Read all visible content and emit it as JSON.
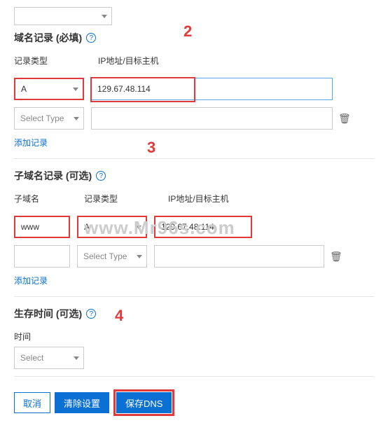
{
  "top_select_placeholder": "",
  "sections": {
    "domain_records": {
      "title": "域名记录 (必填)"
    },
    "subdomain_records": {
      "title": "子域名记录 (可选)"
    },
    "ttl": {
      "title": "生存时间 (可选)"
    }
  },
  "labels": {
    "record_type": "记录类型",
    "ip_target": "IP地址/目标主机",
    "subdomain": "子域名",
    "time": "时间"
  },
  "domain_rows": [
    {
      "type": "A",
      "ip": "129.67.48.114"
    },
    {
      "type": "Select Type",
      "ip": ""
    }
  ],
  "subdomain_rows": [
    {
      "sub": "www",
      "type": "A",
      "ip": "129.67.48.114"
    },
    {
      "sub": "",
      "type": "Select Type",
      "ip": ""
    }
  ],
  "ttl_select": "Select",
  "links": {
    "add_record": "添加记录"
  },
  "buttons": {
    "cancel": "取消",
    "clear": "清除设置",
    "save": "保存DNS"
  },
  "annotations": {
    "a2": "2",
    "a3": "3",
    "a4": "4"
  },
  "watermark": "www.Mr96s.com",
  "icons": {
    "trash": "🗑"
  }
}
